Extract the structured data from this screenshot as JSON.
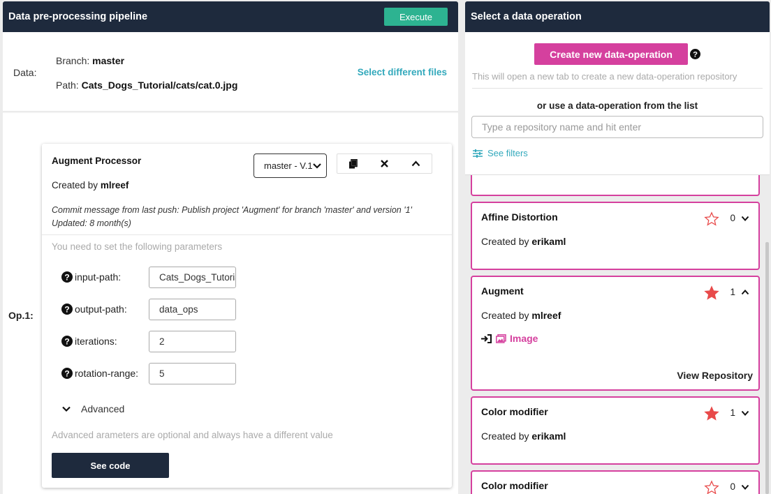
{
  "pipeline": {
    "title": "Data pre-processing pipeline",
    "execute_label": "Execute",
    "data_label": "Data:",
    "branch_label": "Branch:",
    "branch_value": "master",
    "path_label": "Path:",
    "path_value": "Cats_Dogs_Tutorial/cats/cat.0.jpg",
    "select_files_label": "Select different files",
    "op_label": "Op.1:"
  },
  "processor": {
    "title": "Augment Processor",
    "created_by_label": "Created by",
    "author": "mlreef",
    "version_select": "master - V.1",
    "commit_message": "Commit message from last push: Publish project 'Augment' for branch 'master' and version '1'",
    "updated": "Updated: 8 month(s)",
    "params_note": "You need to set the following parameters",
    "params": [
      {
        "label": "input-path:",
        "value": "Cats_Dogs_Tutorial"
      },
      {
        "label": "output-path:",
        "value": "data_ops"
      },
      {
        "label": "iterations:",
        "value": "2"
      },
      {
        "label": "rotation-range:",
        "value": "5"
      }
    ],
    "advanced_label": "Advanced",
    "advanced_note": "Advanced arameters are optional and always have a different value",
    "see_code_label": "See code"
  },
  "selector": {
    "title": "Select a data operation",
    "create_label": "Create new data-operation",
    "new_tab_note": "This will open a new tab to create a new data-operation repository",
    "or_use_label": "or use a data-operation from the list",
    "search_placeholder": "Type a repository name and hit enter",
    "filters_label": "See filters",
    "operations": [
      {
        "name": "Affine Distortion",
        "created_by": "Created by",
        "author": "erikaml",
        "stars": "0",
        "starred": false
      },
      {
        "name": "Augment",
        "created_by": "Created by",
        "author": "mlreef",
        "stars": "1",
        "starred": true,
        "tag": "Image",
        "view_repo": "View Repository"
      },
      {
        "name": "Color modifier",
        "created_by": "Created by",
        "author": "erikaml",
        "stars": "1",
        "starred": true
      },
      {
        "name": "Color modifier",
        "stars": "0",
        "starred": false
      }
    ]
  },
  "colors": {
    "header_bg": "#1e2a3d",
    "execute_green": "#2db391",
    "accent_pink": "#d5409e",
    "link_teal": "#33a9bc",
    "star_red": "#e84a4a"
  }
}
